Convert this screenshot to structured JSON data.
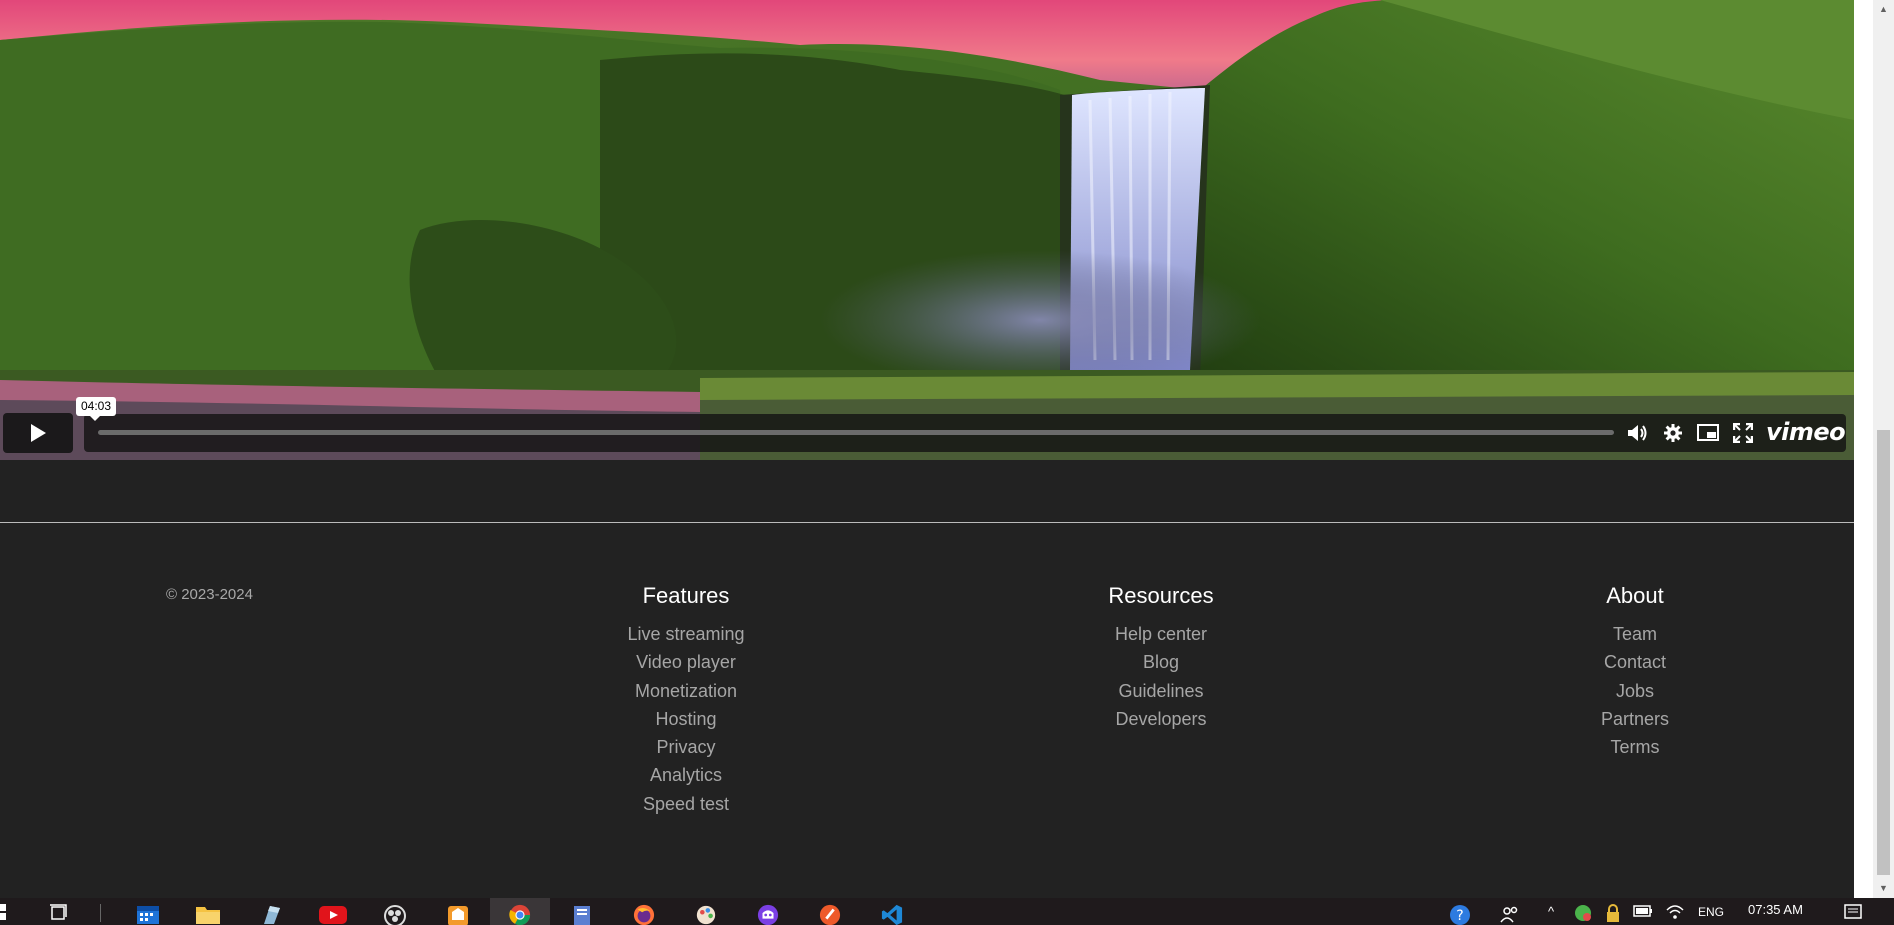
{
  "player": {
    "time_tooltip": "04:03",
    "brand": "vimeo",
    "progress": 0
  },
  "footer": {
    "copyright": "© 2023-2024",
    "features": {
      "title": "Features",
      "items": [
        "Live streaming",
        "Video player",
        "Monetization",
        "Hosting",
        "Privacy",
        "Analytics",
        "Speed test"
      ]
    },
    "resources": {
      "title": "Resources",
      "items": [
        "Help center",
        "Blog",
        "Guidelines",
        "Developers"
      ]
    },
    "about": {
      "title": "About",
      "items": [
        "Team",
        "Contact",
        "Jobs",
        "Partners",
        "Terms"
      ]
    }
  },
  "taskbar": {
    "time": "07:35 AM",
    "language": "ENG",
    "apps": [
      "start-icon",
      "task-view-icon",
      "calendar-icon",
      "file-explorer-icon",
      "pen-tablet-icon",
      "youtube-icon",
      "obs-icon",
      "app-orange-icon",
      "chrome-icon",
      "notepad-icon",
      "firefox-icon",
      "paint-icon",
      "proton-icon",
      "app-red-icon",
      "vscode-icon"
    ]
  },
  "colors": {
    "page_bg": "#222222",
    "text_muted": "#a6a6a6",
    "heading": "#ffffff"
  }
}
